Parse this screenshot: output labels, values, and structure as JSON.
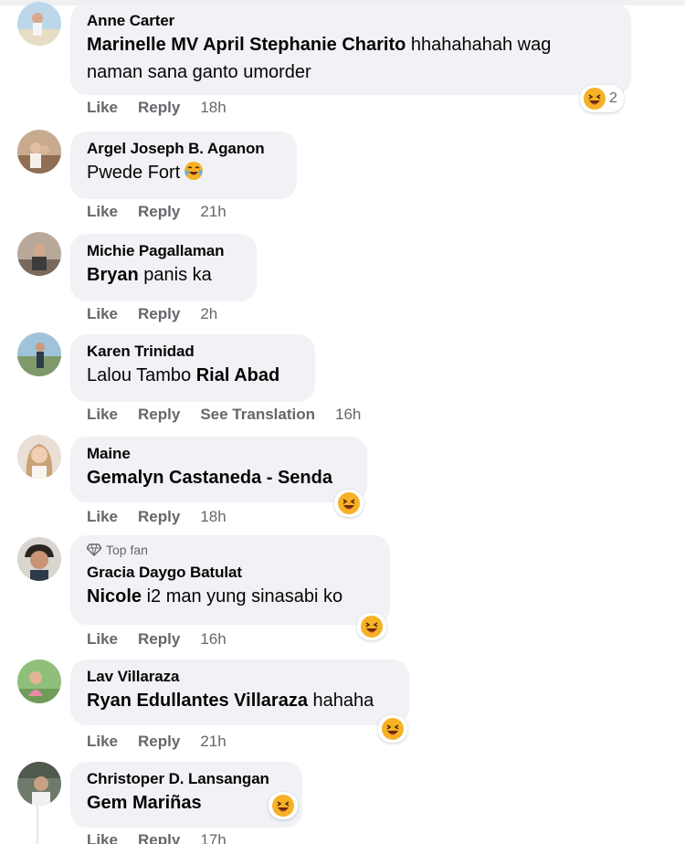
{
  "actions": {
    "like": "Like",
    "reply": "Reply",
    "see_translation": "See Translation"
  },
  "comments": [
    {
      "author": "Anne Carter",
      "mention": "Marinelle MV April Stephanie Charito",
      "text": " hhahahahah wag",
      "text2": "naman sana ganto umorder",
      "time": "18h",
      "reaction_count": "2"
    },
    {
      "author": "Argel Joseph B. Aganon",
      "text": "Pwede Fort",
      "time": "21h"
    },
    {
      "author": "Michie Pagallaman",
      "mention": "Bryan",
      "text": " panis ka",
      "time": "2h"
    },
    {
      "author": "Karen Trinidad",
      "text": "Lalou Tambo ",
      "mention": "Rial Abad",
      "time": "16h"
    },
    {
      "author": "Maine",
      "mention": "Gemalyn Castaneda - Senda",
      "time": "18h"
    },
    {
      "author": "Gracia Daygo Batulat",
      "badge": "Top fan",
      "mention": "Nicole",
      "text": " i2 man yung sinasabi ko",
      "time": "16h"
    },
    {
      "author": "Lav Villaraza",
      "mention": "Ryan Edullantes Villaraza",
      "text": " hahaha",
      "time": "21h"
    },
    {
      "author": "Christoper D. Lansangan",
      "mention": "Gem Mariñas",
      "time": "17h"
    }
  ],
  "reaction_icon": "laughing-face-icon",
  "colors": {
    "bubble": "#f0f2f5",
    "meta": "#65676b",
    "text": "#050505",
    "emoji": "#f7b125"
  }
}
